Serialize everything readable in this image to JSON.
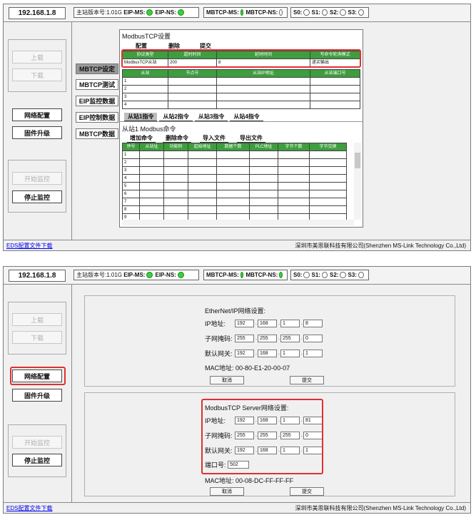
{
  "header": {
    "ip": "192.168.1.8",
    "version_label": "主站版本号:1.01G",
    "eip_ms": "EIP-MS:",
    "eip_ns": "EIP-NS:",
    "mbtcp_ms": "MBTCP-MS:",
    "mbtcp_ns": "MBTCP-NS:",
    "s0": "S0:",
    "s1": "S1:",
    "s2": "S2:",
    "s3": "S3:"
  },
  "left_buttons": {
    "upload": "上载",
    "download": "下载",
    "network_config": "网络配置",
    "firmware_upgrade": "固件升级",
    "start_monitor": "开始监控",
    "stop_monitor": "停止监控"
  },
  "tabs": [
    "MBTCP设定",
    "MBTCP测试",
    "EIP监控数据",
    "EIP控制数据",
    "MBTCP数据"
  ],
  "modbus": {
    "title": "ModbusTCP设置",
    "buttons": [
      "配置",
      "删除",
      "提交"
    ],
    "config_headers": [
      "协议类型",
      "超时时间",
      "延时时间",
      "写命令轮询模式"
    ],
    "config_values": [
      "ModbusTCP从站",
      "200",
      "8",
      "遂买输出"
    ],
    "slave_headers": [
      "从站",
      "节点号",
      "从站IP地址",
      "从站端口号"
    ],
    "slave_rows": [
      "1",
      "2",
      "3",
      "4"
    ],
    "subtabs": [
      "从站1指令",
      "从站2指令",
      "从站3指令",
      "从站4指令"
    ],
    "cmd_title": "从站1 Modbus命令",
    "cmd_buttons": [
      "增加命令",
      "删除命令",
      "导入文件",
      "导出文件"
    ],
    "cmd_headers": [
      "序号",
      "从站址",
      "功能码",
      "起始地址",
      "数据个数",
      "PLC地址",
      "字节个数",
      "字节交换"
    ],
    "cmd_rows": [
      "1",
      "2",
      "3",
      "4",
      "5",
      "6",
      "7",
      "8",
      "9"
    ]
  },
  "footer": {
    "eds_link": "EDS配置文件下载",
    "company": "深圳市美思联科技有限公司(Shenzhen MS-Link Technology Co.,Ltd)"
  },
  "network": {
    "eip_title": "EtherNet/IP网络设置:",
    "mbtcp_title": "ModbusTCP Server网络设置:",
    "ip_label": "IP地址:",
    "mask_label": "子网掩码:",
    "gw_label": "默认网关:",
    "port_label": "端口号:",
    "mac_label": "MAC地址:",
    "eip_ip": [
      "192",
      "168",
      "1",
      "8"
    ],
    "eip_mask": [
      "255",
      "255",
      "255",
      "0"
    ],
    "eip_gw": [
      "192",
      "168",
      "1",
      "1"
    ],
    "eip_mac": "00-80-E1-20-00-07",
    "mb_ip": [
      "192",
      "168",
      "1",
      "81"
    ],
    "mb_mask": [
      "255",
      "255",
      "255",
      "0"
    ],
    "mb_gw": [
      "192",
      "168",
      "1",
      "1"
    ],
    "mb_port": "502",
    "mb_mac": "00-08-DC-FF-FF-FF",
    "cancel": "取消",
    "submit": "提交"
  },
  "colors": {
    "led_on": "#38d23a",
    "highlight": "#e03030",
    "grid_header": "#3e9d3e",
    "link": "#0000ee"
  }
}
